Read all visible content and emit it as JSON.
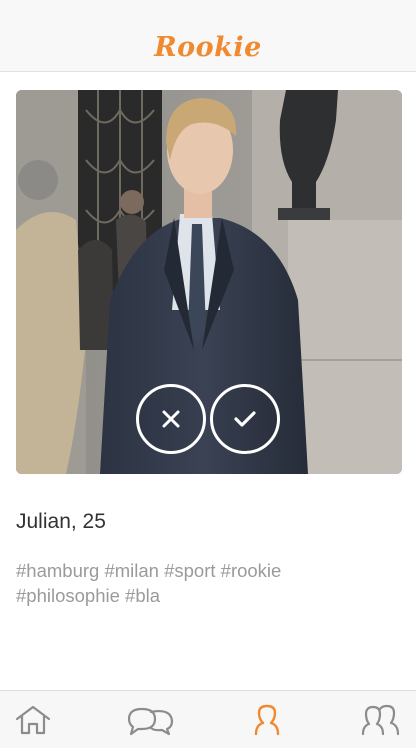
{
  "header": {
    "title": "Rookie"
  },
  "profile": {
    "name_age": "Julian, 25",
    "tags": [
      "#hamburg",
      "#milan",
      "#sport",
      "#rookie",
      "#philosophie",
      "#bla"
    ]
  },
  "actions": {
    "reject_icon": "close-icon",
    "accept_icon": "checkmark-icon"
  },
  "tabbar": {
    "items": [
      {
        "icon": "home-icon",
        "active": false
      },
      {
        "icon": "chat-icon",
        "active": false
      },
      {
        "icon": "profile-icon",
        "active": true
      },
      {
        "icon": "friends-icon",
        "active": false
      }
    ],
    "active_color": "#f08a30",
    "inactive_color": "#8c8c8c"
  },
  "colors": {
    "accent": "#f08a30"
  }
}
